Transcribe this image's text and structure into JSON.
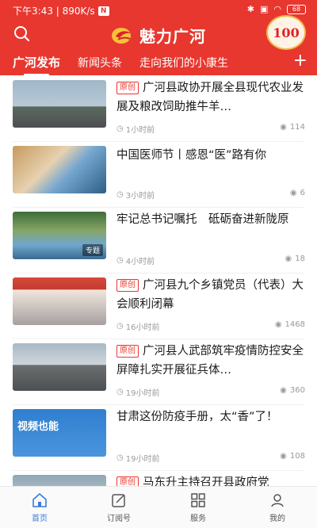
{
  "status": {
    "time_speed": "下午3:43 | 890K/s",
    "app_badge": "N",
    "battery": "68"
  },
  "header": {
    "app_title": "魅力广河",
    "badge_text": "100",
    "accent_color": "#e8372f"
  },
  "tabs": [
    {
      "label": "广河发布",
      "active": true
    },
    {
      "label": "新闻头条",
      "active": false
    },
    {
      "label": "走向我们的小康生",
      "active": false
    }
  ],
  "tab_more": "+",
  "articles": [
    {
      "tag": "原创",
      "title": "广河县政协开展全县现代农业发展及粮改饲助推牛羊…",
      "time": "1小时前",
      "views": "114",
      "topic": ""
    },
    {
      "tag": "",
      "title": "中国医师节丨感恩“医”路有你",
      "time": "3小时前",
      "views": "6",
      "topic": ""
    },
    {
      "tag": "",
      "title": "牢记总书记嘱托　砥砺奋进新陇原",
      "time": "4小时前",
      "views": "18",
      "topic": "专题"
    },
    {
      "tag": "原创",
      "title": "广河县九个乡镇党员（代表）大会顺利闭幕",
      "time": "16小时前",
      "views": "1468",
      "topic": ""
    },
    {
      "tag": "原创",
      "title": "广河县人武部筑牢疫情防控安全屏障扎实开展征兵体…",
      "time": "19小时前",
      "views": "360",
      "topic": ""
    },
    {
      "tag": "",
      "title": "甘肃这份防疫手册，太“香”了！",
      "time": "19小时前",
      "views": "108",
      "topic": "",
      "thumb_caption": "视频也能"
    },
    {
      "tag": "原创",
      "title": "马东升主持召开县政府党",
      "time": "",
      "views": "",
      "topic": ""
    }
  ],
  "bottom_nav": [
    {
      "label": "首页",
      "icon": "home-icon",
      "active": true
    },
    {
      "label": "订阅号",
      "icon": "subscribe-icon",
      "active": false
    },
    {
      "label": "服务",
      "icon": "grid-icon",
      "active": false
    },
    {
      "label": "我的",
      "icon": "user-icon",
      "active": false
    }
  ]
}
